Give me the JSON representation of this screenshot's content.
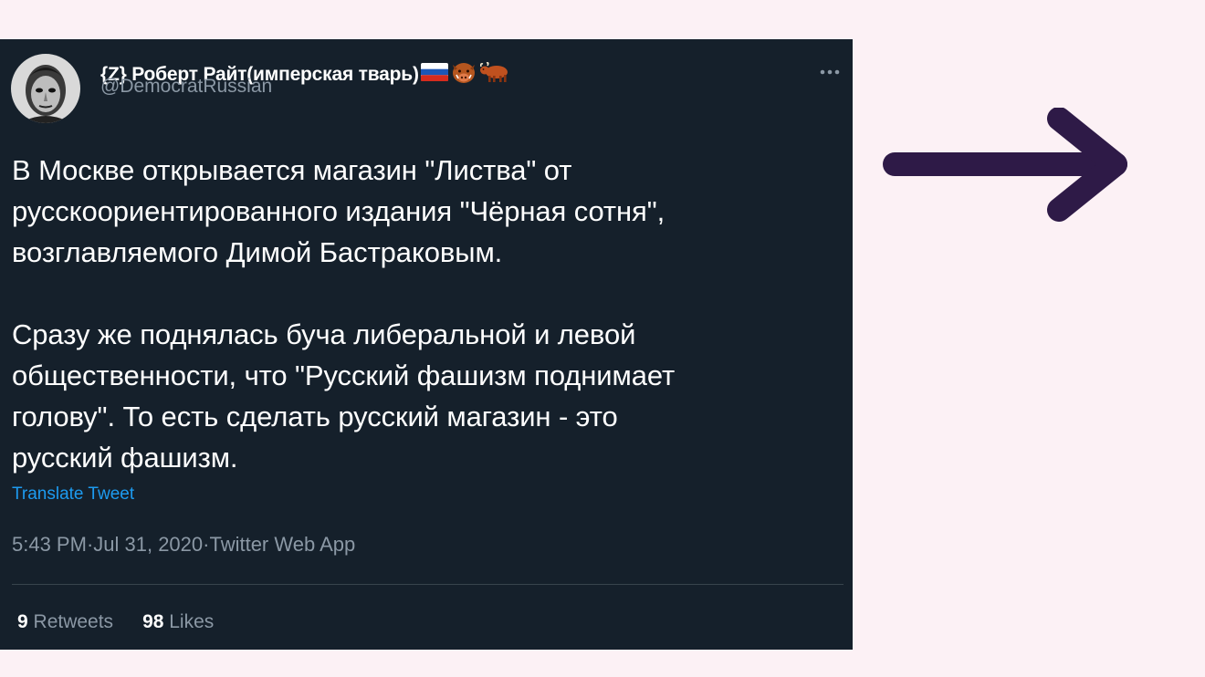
{
  "tweet": {
    "display_name": "{Z} Роберт Райт(имперская тварь)",
    "badges": [
      "russian-flag-emoji",
      "boar-emoji",
      "ox-emoji"
    ],
    "handle": "@DemocratRussian",
    "paragraphs": [
      "В Москве открывается магазин \"Листва\" от\nрусскоориентированного издания \"Чёрная сотня\",\nвозглавляемого Димой Бастраковым.",
      "Сразу же поднялась буча либеральной и левой\nобщественности, что \"Русский фашизм поднимает\nголову\". То есть сделать русский магазин - это\nрусский фашизм."
    ],
    "translate_label": "Translate Tweet",
    "time": "5:43 PM",
    "date": "Jul 31, 2020",
    "source": "Twitter Web App",
    "separator": " · ",
    "retweets_count": "9",
    "retweets_label": " Retweets",
    "likes_count": "98",
    "likes_label": " Likes"
  },
  "colors": {
    "page_bg": "#fcf1f5",
    "tweet_bg": "#15202b",
    "text_primary": "#ffffff",
    "text_secondary": "#8b98a5",
    "link": "#1d9bf0",
    "arrow": "#2e1a47"
  }
}
